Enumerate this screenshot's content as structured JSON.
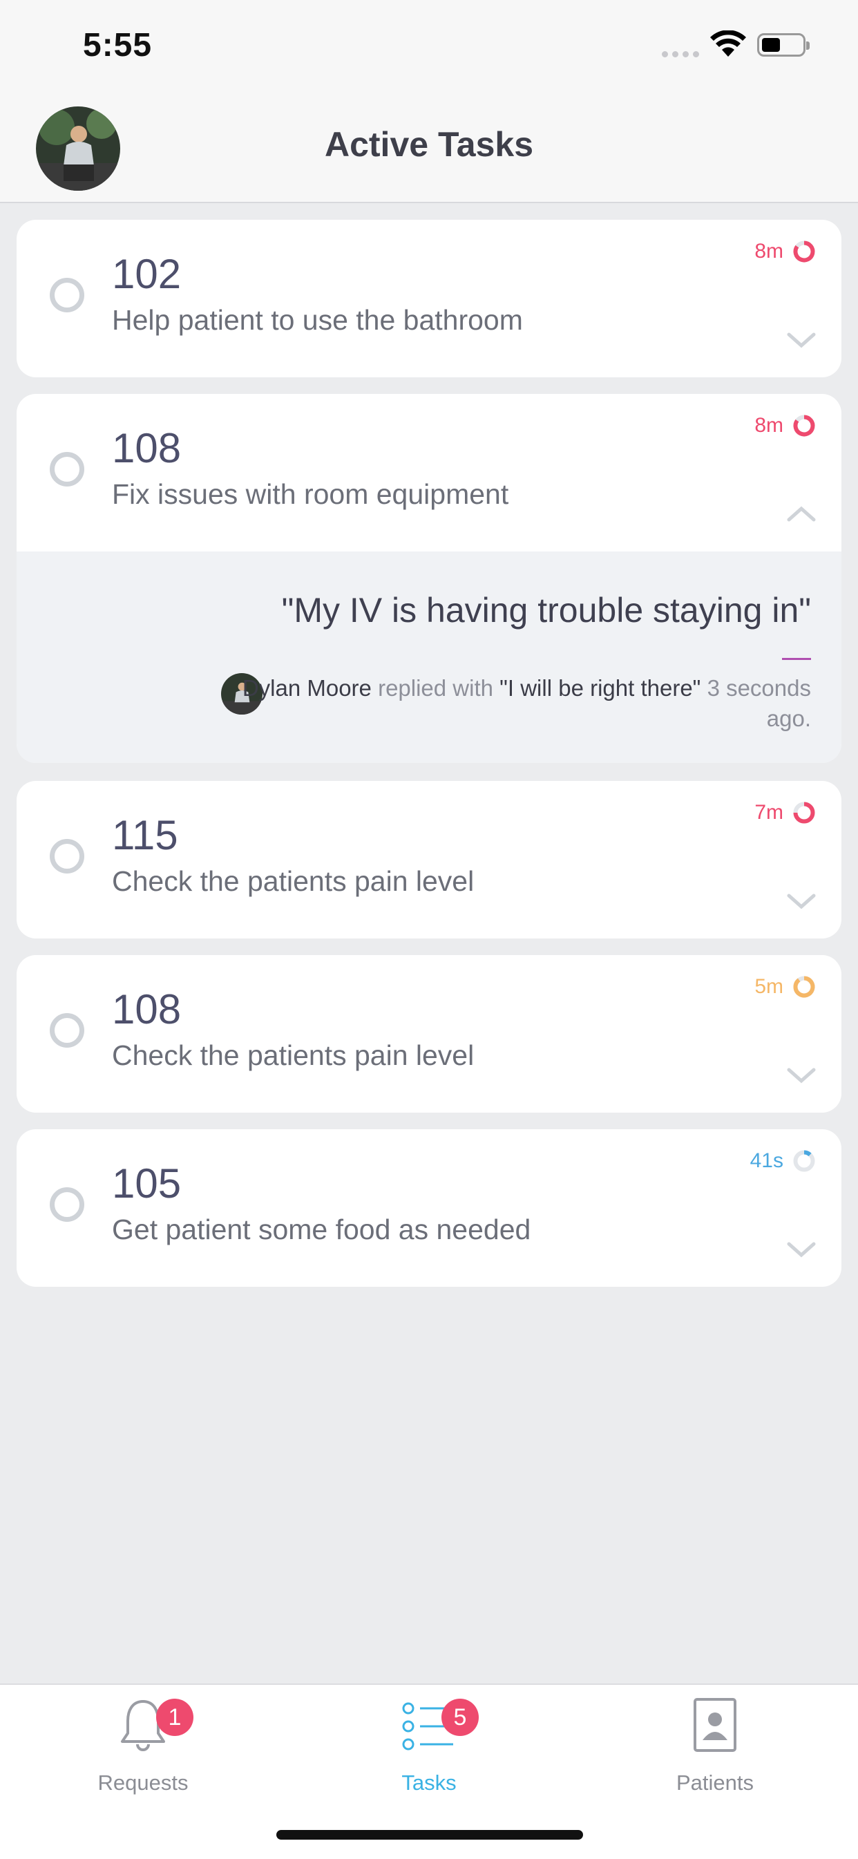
{
  "status_bar": {
    "time": "5:55"
  },
  "header": {
    "title": "Active Tasks"
  },
  "tasks": [
    {
      "room": "102",
      "description": "Help patient to use the bathroom",
      "timer": "8m",
      "timer_color": "#ee4a6e",
      "progress": 0.85,
      "expanded": false
    },
    {
      "room": "108",
      "description": "Fix issues with room equipment",
      "timer": "8m",
      "timer_color": "#ee4a6e",
      "progress": 0.85,
      "expanded": true
    },
    {
      "room": "115",
      "description": "Check the patients pain level",
      "timer": "7m",
      "timer_color": "#ee4a6e",
      "progress": 0.75,
      "expanded": false
    },
    {
      "room": "108",
      "description": "Check the patients pain level",
      "timer": "5m",
      "timer_color": "#f5b767",
      "progress": 0.9,
      "expanded": false
    },
    {
      "room": "105",
      "description": "Get patient some food as needed",
      "timer": "41s",
      "timer_color": "#4ba8e0",
      "progress": 0.12,
      "expanded": false
    }
  ],
  "expanded_detail": {
    "quote": "\"My IV is having trouble staying in\"",
    "reply_name": "Dylan Moore",
    "reply_mid": "replied with",
    "reply_text": "\"I will be right there\"",
    "reply_time": "3 seconds ago."
  },
  "tabs": [
    {
      "label": "Requests",
      "badge": "1",
      "active": false
    },
    {
      "label": "Tasks",
      "badge": "5",
      "active": true
    },
    {
      "label": "Patients",
      "badge": "",
      "active": false
    }
  ],
  "colors": {
    "accent": "#3ab2e4",
    "badge": "#ee4a6e",
    "urgent": "#ee4a6e",
    "warning": "#f5b767",
    "normal": "#4ba8e0"
  }
}
